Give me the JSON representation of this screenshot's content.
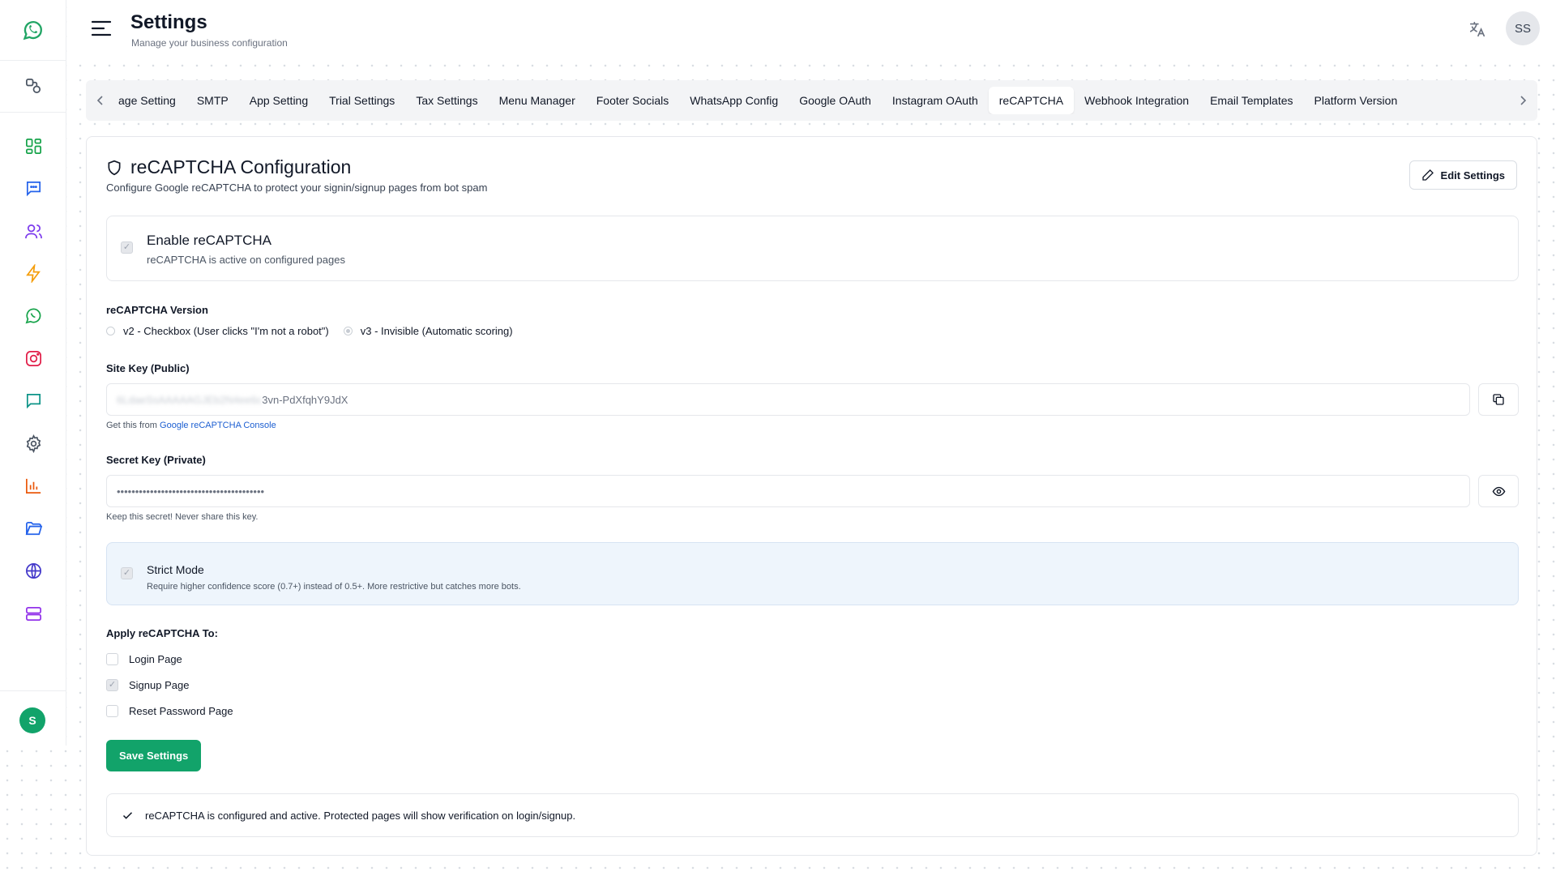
{
  "header": {
    "title": "Settings",
    "subtitle": "Manage your business configuration",
    "user_initials": "SS"
  },
  "sidebar": {
    "avatar_initial": "S",
    "items": [
      {
        "icon": "whatsapp-logo-icon",
        "color": "#22a565"
      },
      {
        "icon": "shapes-icon",
        "color": "#4b5563"
      },
      {
        "icon": "dashboard-icon",
        "color": "#16a34a"
      },
      {
        "icon": "chat-icon",
        "color": "#2563eb"
      },
      {
        "icon": "users-icon",
        "color": "#7c3aed"
      },
      {
        "icon": "lightning-icon",
        "color": "#f59e0b"
      },
      {
        "icon": "whatsapp-icon",
        "color": "#16a34a"
      },
      {
        "icon": "instagram-icon",
        "color": "#e11d48"
      },
      {
        "icon": "message-icon",
        "color": "#0d9488"
      },
      {
        "icon": "gear-icon",
        "color": "#4b5563"
      },
      {
        "icon": "bar-chart-icon",
        "color": "#ea580c"
      },
      {
        "icon": "folder-icon",
        "color": "#2563eb"
      },
      {
        "icon": "globe-icon",
        "color": "#4338ca"
      },
      {
        "icon": "server-icon",
        "color": "#9333ea"
      }
    ]
  },
  "tabs": [
    {
      "label": "age Setting",
      "active": false
    },
    {
      "label": "SMTP",
      "active": false
    },
    {
      "label": "App Setting",
      "active": false
    },
    {
      "label": "Trial Settings",
      "active": false
    },
    {
      "label": "Tax Settings",
      "active": false
    },
    {
      "label": "Menu Manager",
      "active": false
    },
    {
      "label": "Footer Socials",
      "active": false
    },
    {
      "label": "WhatsApp Config",
      "active": false
    },
    {
      "label": "Google OAuth",
      "active": false
    },
    {
      "label": "Instagram OAuth",
      "active": false
    },
    {
      "label": "reCAPTCHA",
      "active": true
    },
    {
      "label": "Webhook Integration",
      "active": false
    },
    {
      "label": "Email Templates",
      "active": false
    },
    {
      "label": "Platform Version",
      "active": false
    }
  ],
  "card": {
    "title": "reCAPTCHA Configuration",
    "description": "Configure Google reCAPTCHA to protect your signin/signup pages from bot spam",
    "edit_label": "Edit Settings"
  },
  "enable": {
    "title": "Enable reCAPTCHA",
    "description": "reCAPTCHA is active on configured pages",
    "checked": true
  },
  "version": {
    "label": "reCAPTCHA Version",
    "options": [
      {
        "label": "v2 - Checkbox (User clicks \"I'm not a robot\")",
        "selected": false
      },
      {
        "label": "v3 - Invisible (Automatic scoring)",
        "selected": true
      }
    ]
  },
  "site_key": {
    "label": "Site Key (Public)",
    "value_hidden": "6LdaeSsAAAAAGJEb2N4ee6c",
    "value_visible": "3vn-PdXfqhY9JdX",
    "hint_prefix": "Get this from ",
    "hint_link": "Google reCAPTCHA Console"
  },
  "secret_key": {
    "label": "Secret Key (Private)",
    "value": "••••••••••••••••••••••••••••••••••••••••",
    "hint": "Keep this secret! Never share this key."
  },
  "strict": {
    "title": "Strict Mode",
    "description": "Require higher confidence score (0.7+) instead of 0.5+. More restrictive but catches more bots.",
    "checked": true
  },
  "apply": {
    "label": "Apply reCAPTCHA To:",
    "items": [
      {
        "label": "Login Page",
        "checked": false
      },
      {
        "label": "Signup Page",
        "checked": true
      },
      {
        "label": "Reset Password Page",
        "checked": false
      }
    ]
  },
  "save_label": "Save Settings",
  "status_message": "reCAPTCHA is configured and active. Protected pages will show verification on login/signup."
}
